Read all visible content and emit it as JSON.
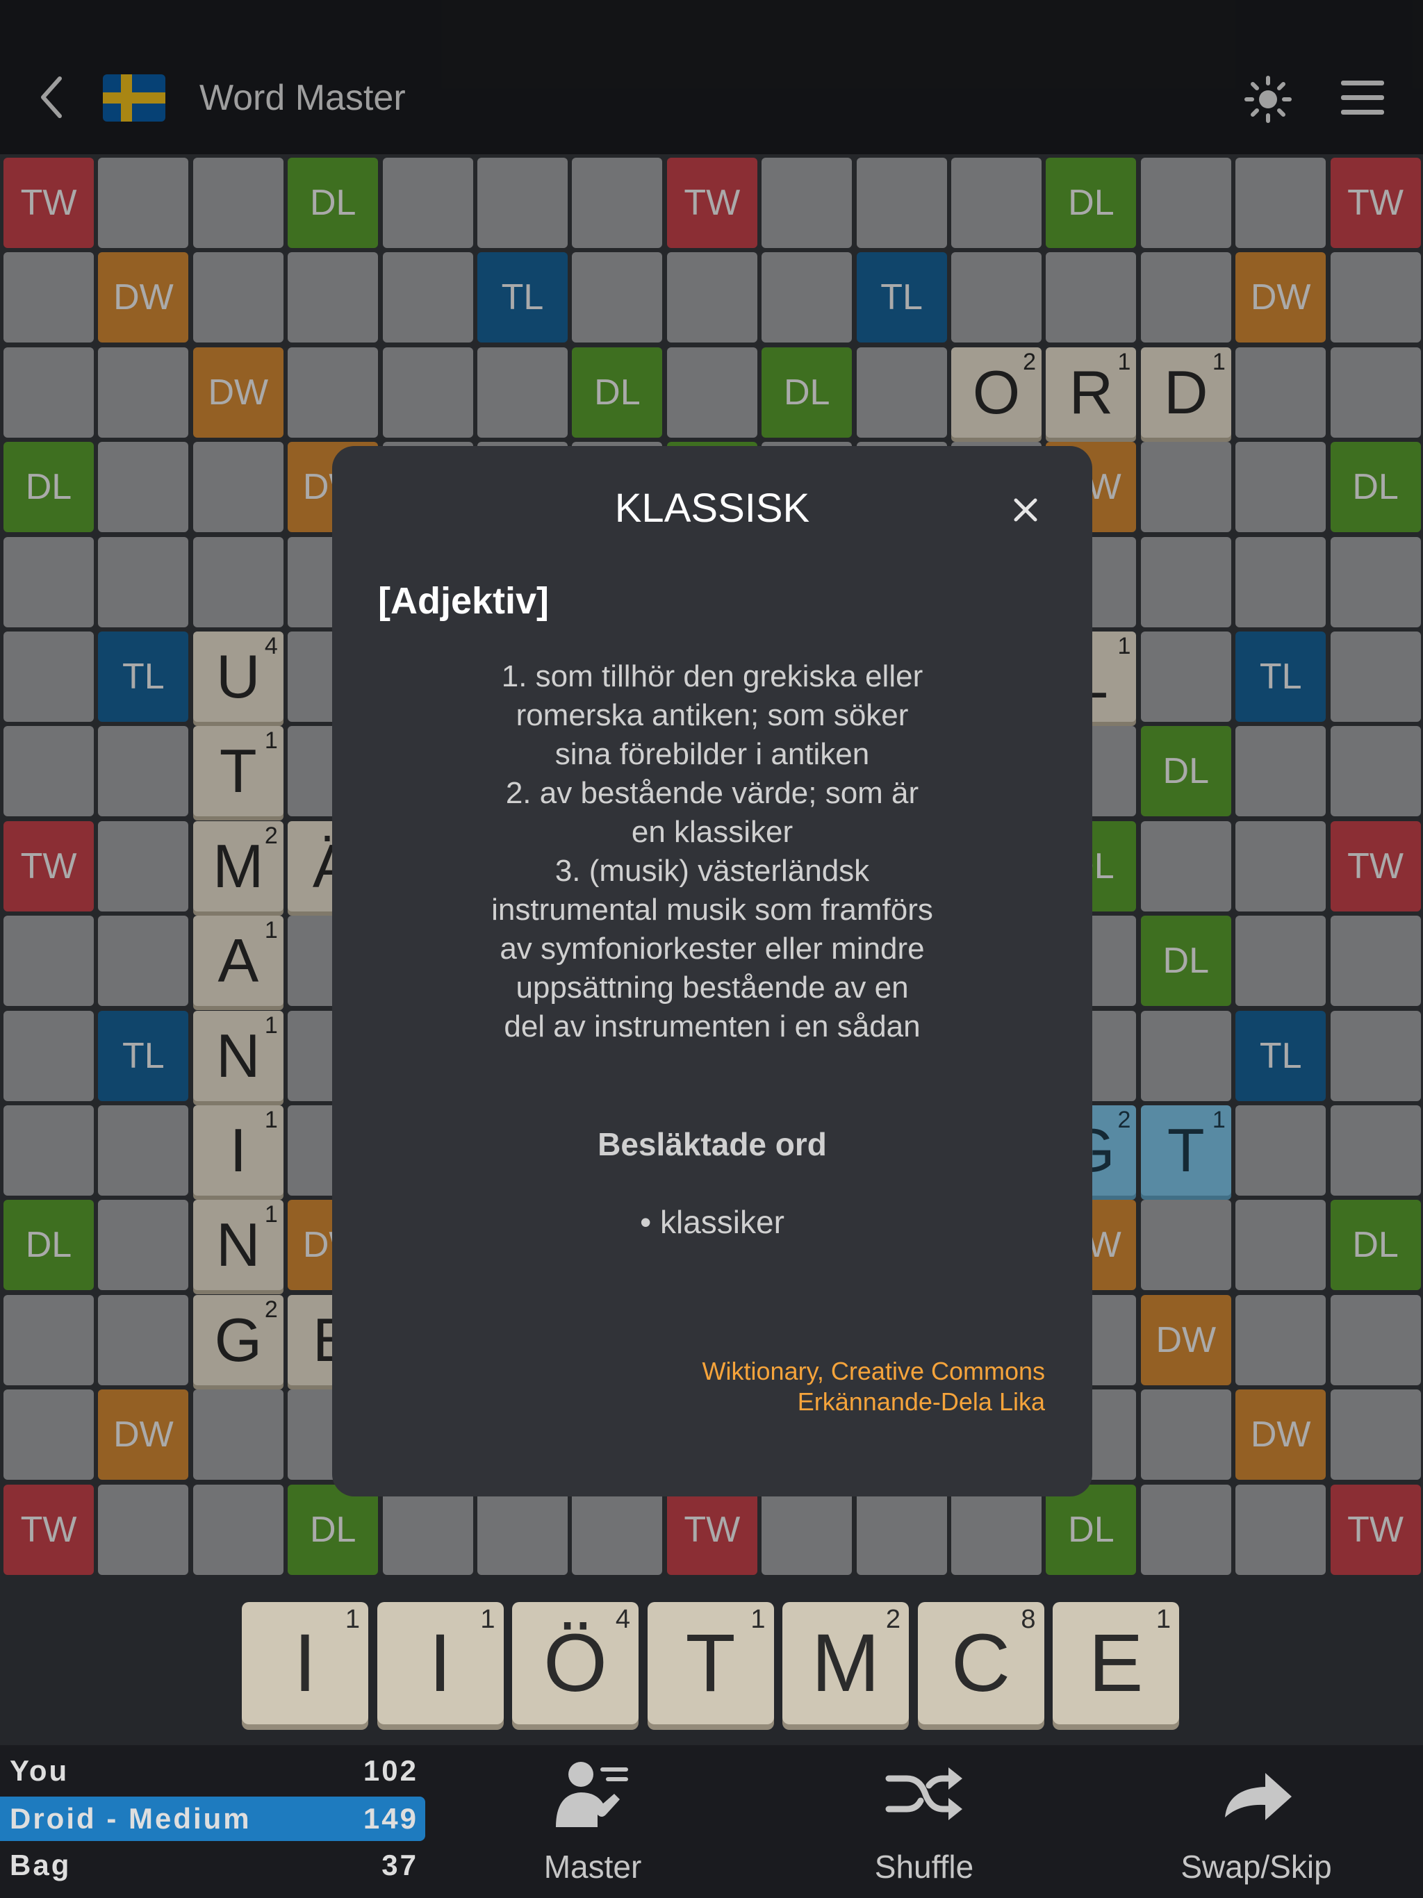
{
  "header": {
    "title": "Word Master",
    "flag": "sweden-flag",
    "theme_icon": "sun-icon",
    "menu_icon": "hamburger-menu-icon"
  },
  "board": {
    "premium_labels": {
      "TW": "TW",
      "DW": "DW",
      "TL": "TL",
      "DL": "DL"
    },
    "colors": {
      "TW": "#c8424b",
      "DW": "#d48a34",
      "TL": "#17639a",
      "DL": "#5a9f2e",
      "empty": "#a3a4a7",
      "tile": "#e8e0cf",
      "highlight": "#7ec6ea"
    },
    "premium_map": [
      "TW,,,DL,,,,TW,,,,DL,,,TW",
      ",DW,,,,TL,,,,TL,,,,DW,",
      ",,DW,,,,DL,,DL,,,,,,",
      "DL,,,DW,,,,DL,,,,DW,,,DL",
      ",,,,DW,,,,,,DW,,,,",
      ",TL,,,,TL,,,,TL,,,,TL,",
      ",,DL,,,,DL,,DL,,,,DL,,",
      "TW,,,DL,,,,DW,,,,DL,,,TW",
      ",,DL,,,,DL,,DL,,,,DL,,",
      ",TL,,,,TL,,,,TL,,,,TL,",
      ",,,,DW,,,,,,DW,,,,",
      "DL,,,DW,,,,DL,,,,DW,,,DL",
      ",,DW,,,,DL,,DL,,,,DW,,",
      ",DW,,,,TL,,,,TL,,,,DW,",
      "TW,,,DL,,,,TW,,,,DL,,,TW"
    ],
    "tiles": [
      {
        "row": 2,
        "col": 10,
        "letter": "O",
        "points": "2"
      },
      {
        "row": 2,
        "col": 11,
        "letter": "R",
        "points": "1"
      },
      {
        "row": 2,
        "col": 12,
        "letter": "D",
        "points": "1"
      },
      {
        "row": 5,
        "col": 2,
        "letter": "U",
        "points": "4"
      },
      {
        "row": 5,
        "col": 11,
        "letter": "L",
        "points": "1"
      },
      {
        "row": 6,
        "col": 2,
        "letter": "T",
        "points": "1"
      },
      {
        "row": 7,
        "col": 2,
        "letter": "M",
        "points": "2"
      },
      {
        "row": 7,
        "col": 3,
        "letter": "Ä",
        "points": ""
      },
      {
        "row": 8,
        "col": 2,
        "letter": "A",
        "points": "1"
      },
      {
        "row": 9,
        "col": 2,
        "letter": "N",
        "points": "1"
      },
      {
        "row": 10,
        "col": 2,
        "letter": "I",
        "points": "1"
      },
      {
        "row": 10,
        "col": 11,
        "letter": "G",
        "points": "2",
        "highlight": true
      },
      {
        "row": 10,
        "col": 12,
        "letter": "T",
        "points": "1",
        "highlight": true
      },
      {
        "row": 11,
        "col": 2,
        "letter": "N",
        "points": "1"
      },
      {
        "row": 12,
        "col": 2,
        "letter": "G",
        "points": "2"
      },
      {
        "row": 12,
        "col": 3,
        "letter": "E",
        "points": ""
      }
    ]
  },
  "rack": [
    {
      "letter": "I",
      "points": "1"
    },
    {
      "letter": "I",
      "points": "1"
    },
    {
      "letter": "Ö",
      "points": "4"
    },
    {
      "letter": "T",
      "points": "1"
    },
    {
      "letter": "M",
      "points": "2"
    },
    {
      "letter": "C",
      "points": "8"
    },
    {
      "letter": "E",
      "points": "1"
    }
  ],
  "scores": {
    "you_label": "You",
    "you_value": "102",
    "droid_label": "Droid - Medium",
    "droid_value": "149",
    "bag_label": "Bag",
    "bag_value": "37"
  },
  "actions": {
    "master": "Master",
    "shuffle": "Shuffle",
    "swap": "Swap/Skip"
  },
  "modal": {
    "title": "KLASSISK",
    "part_of_speech": "[Adjektiv]",
    "definitions": [
      "1. som tillhör den grekiska eller\nromerska antiken; som söker\nsina förebilder i antiken",
      "2. av bestående värde; som är\nen klassiker",
      "3. (musik) västerländsk\ninstrumental musik som framförs\nav symfoniorkester eller mindre\nuppsättning bestående av en\ndel av instrumenten i en sådan"
    ],
    "related_heading": "Besläktade ord",
    "related_word": "• klassiker",
    "credit_line1": "Wiktionary, Creative Commons",
    "credit_line2": "Erkännande-Dela Lika"
  }
}
